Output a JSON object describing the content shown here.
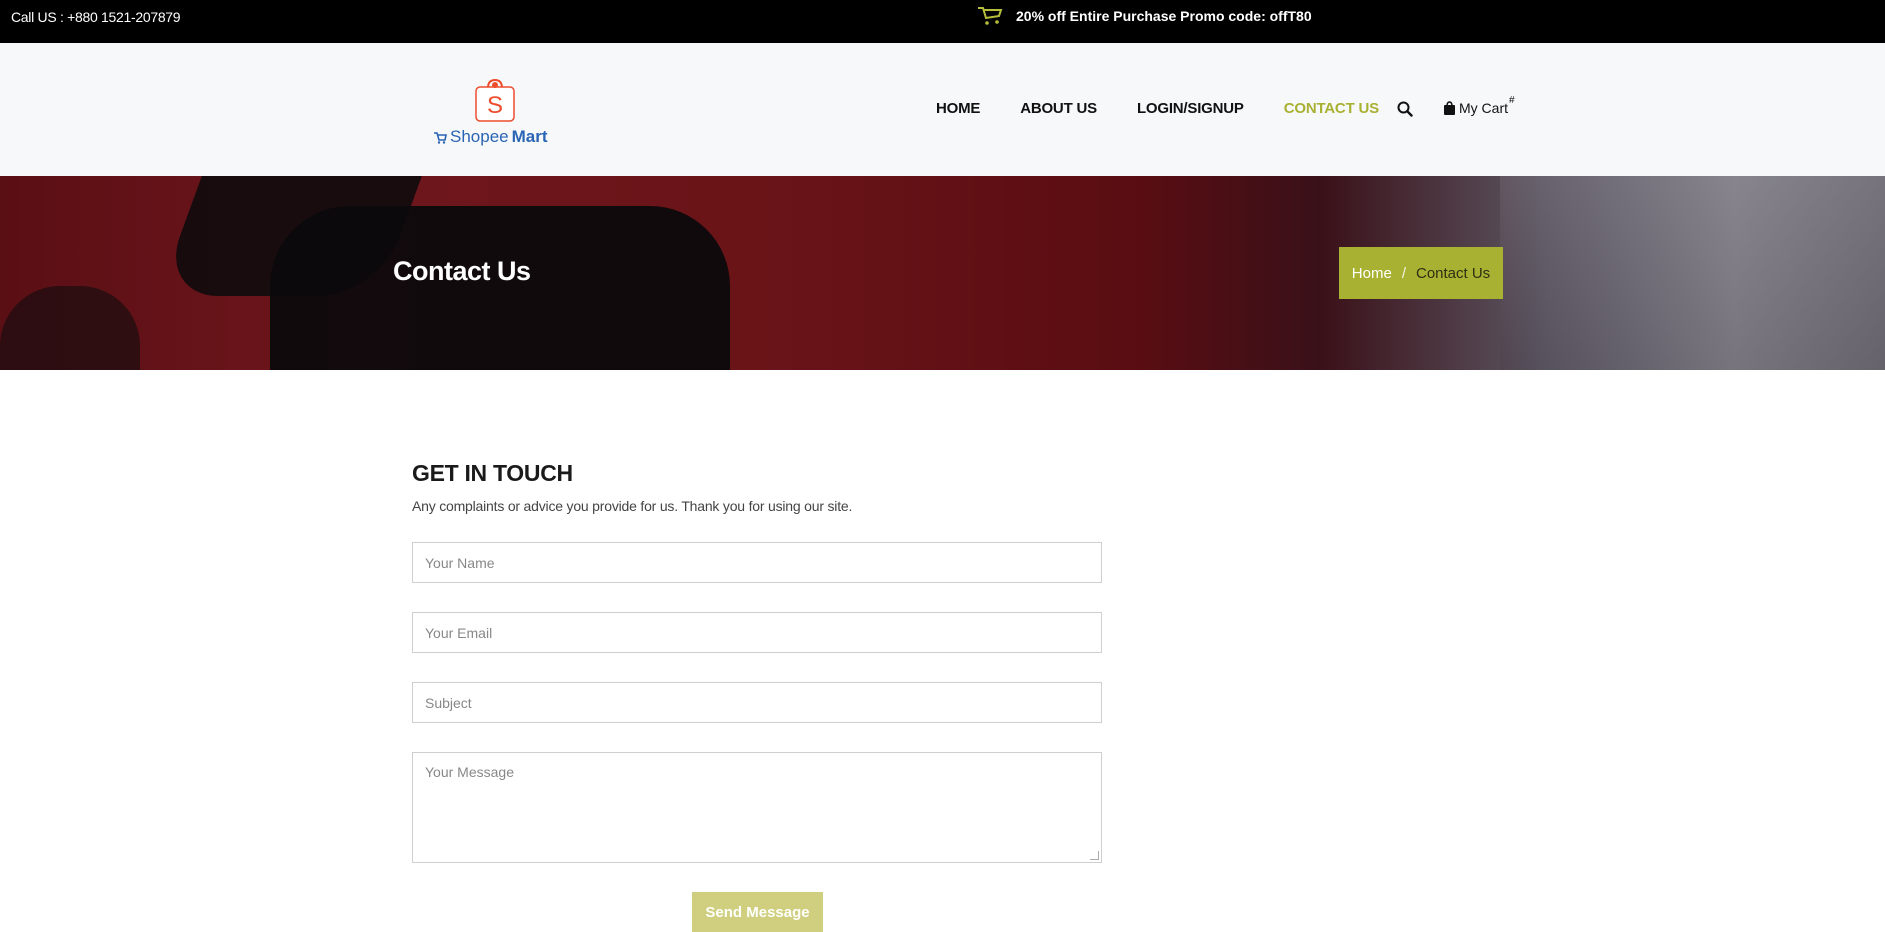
{
  "topbar": {
    "phone": "Call US : +880 1521-207879",
    "promo_icon": "cart-icon",
    "promo": "20% off Entire Purchase Promo code: offT80"
  },
  "header": {
    "logo_text_shopee": "Shopee",
    "logo_text_mart": "Mart",
    "logo_letter": "S",
    "nav": [
      {
        "label": "HOME",
        "active": false
      },
      {
        "label": "ABOUT US",
        "active": false
      },
      {
        "label": "LOGIN/SIGNUP",
        "active": false
      },
      {
        "label": "CONTACT US",
        "active": true
      }
    ],
    "search_icon": "search-icon",
    "cart_label": "My Cart",
    "cart_count": "#"
  },
  "banner": {
    "title": "Contact Us",
    "breadcrumb": {
      "home": "Home",
      "separator": "/",
      "current": "Contact Us"
    }
  },
  "contact": {
    "heading": "GET IN TOUCH",
    "subheading": "Any complaints or advice you provide for us. Thank you for using our site.",
    "name_placeholder": "Your Name",
    "email_placeholder": "Your Email",
    "subject_placeholder": "Subject",
    "message_placeholder": "Your Message",
    "send_label": "Send Message"
  },
  "colors": {
    "accent": "#a9b133",
    "topbar_bg": "#000000",
    "header_bg": "#f7f8fa",
    "button_bg": "#cfcf7f"
  }
}
